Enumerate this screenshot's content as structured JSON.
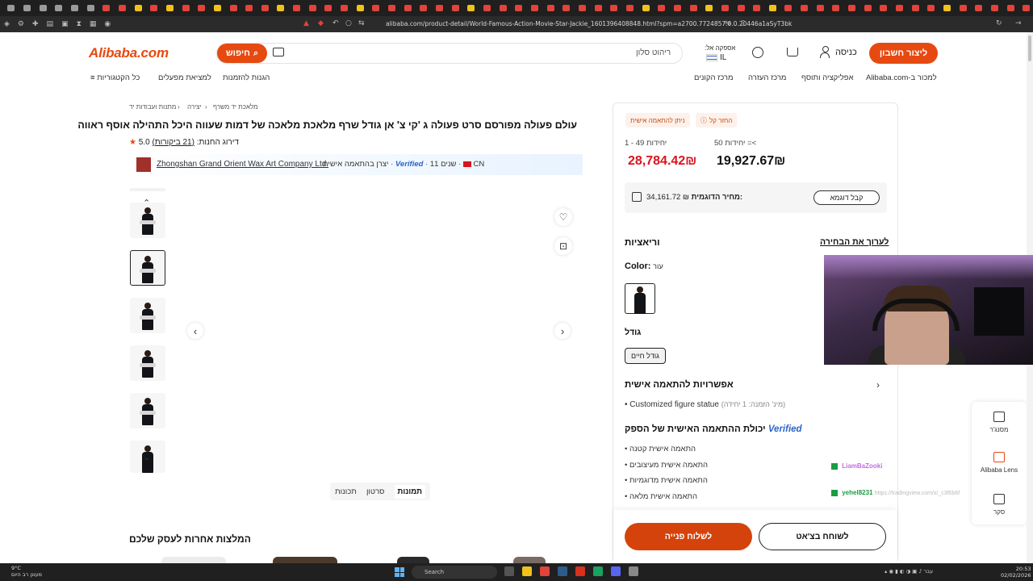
{
  "browser": {
    "url": "alibaba.com/product-detail/World-Famous-Action-Movie-Star-Jackie_1601396408848.html?spm=a2700.7724857.0.0.20446a1aSyT3bk"
  },
  "header": {
    "logo": "Alibaba.com",
    "search_button": "חיפוש",
    "search_value": "ריהוט סלון",
    "deliver_to": "אספקה אל:",
    "country": "IL",
    "sign_in": "כניסה",
    "create_account": "ליצור חשבון"
  },
  "nav": {
    "all_categories": "כל הקטגוריות",
    "find_factories": "למציאת מפעלים",
    "order_protection": "הגנות להזמנות",
    "buyers_center": "מרכז הקונים",
    "help_center": "מרכז העזרה",
    "app": "אפליקציה ותוסף",
    "sell": "Alibaba.com-למכור ב"
  },
  "breadcrumb": {
    "b1": "מתנות ועבודות יד",
    "b2": "יצירה",
    "b3": "מלאכת יד משרף"
  },
  "product": {
    "title": "עולם פעולה מפורסם סרט פעולה ג 'קי צ' אן גודל שרף מלאכת מלאכה של דמות שעווה היכל התהילה אוסף ראווה",
    "rating": "5.0",
    "reviews": "(21 ביקורות)",
    "rating_label": "דירוג החנות:",
    "supplier_name": "Zhongshan Grand Orient Wax Art Company Ltd.",
    "supplier_type": "יצרן בהתאמה אישית",
    "verified": "Verified",
    "years": "שנים 11",
    "country_code": "CN"
  },
  "media": {
    "tab_photos": "תמונות",
    "tab_video": "סרטון",
    "tab_features": "תכונות"
  },
  "recommendations": {
    "title": "המלצות אחרות לעסק שלכם"
  },
  "panel": {
    "badge_refund": "החזר קל",
    "badge_custom": "ניתן להתאמה אישית",
    "tier1_label": "יחידות 49 - 1",
    "tier1_price": "28,784.42₪",
    "tier2_label": "יחידות 50 =<",
    "tier2_price": "19,927.67₪",
    "sample_label": "מחיר הדוגמית:",
    "sample_price": "34,161.72 ₪",
    "sample_button": "קבל דוגמא",
    "variations": "וריאציות",
    "edit_selection": "לערוך את הבחירה",
    "color_label": "Color:",
    "color_value": "עור",
    "size_label": "גודל",
    "size_value": "גודל חיים",
    "custom_title": "אפשרויות להתאמה אישית",
    "custom_item": "Customized figure statue",
    "custom_min": "(מינ' הזמנה: 1 יחידה)",
    "capability_title": "יכולת ההתאמה האישית של הספק",
    "capability_verified": "Verified",
    "cap_items": [
      "התאמה אישית קטנה",
      "התאמה אישית מעיצובים",
      "התאמה אישית מדוגמיות",
      "התאמה אישית מלאה"
    ],
    "send_inquiry": "לשלוח פנייה",
    "chat_now": "לשוחח בצ'אט"
  },
  "sidebar": {
    "messenger": "מסנג'ר",
    "lens": "Alibaba Lens",
    "survey": "סקר"
  },
  "chat_overlay": {
    "user1": "LiamBaZooki",
    "user2": "yehel8231",
    "user2_msg": "https://tradingview.com/x/_c3f6b6f"
  },
  "taskbar": {
    "temp": "9°C",
    "weather": "מעונן רב היום",
    "search": "Search",
    "time": "20:53",
    "date": "02/02/2026",
    "lang": "עבר"
  },
  "colors": {
    "accent": "#e64a10",
    "price_red": "#d8141e",
    "verified_blue": "#2d64c9"
  }
}
